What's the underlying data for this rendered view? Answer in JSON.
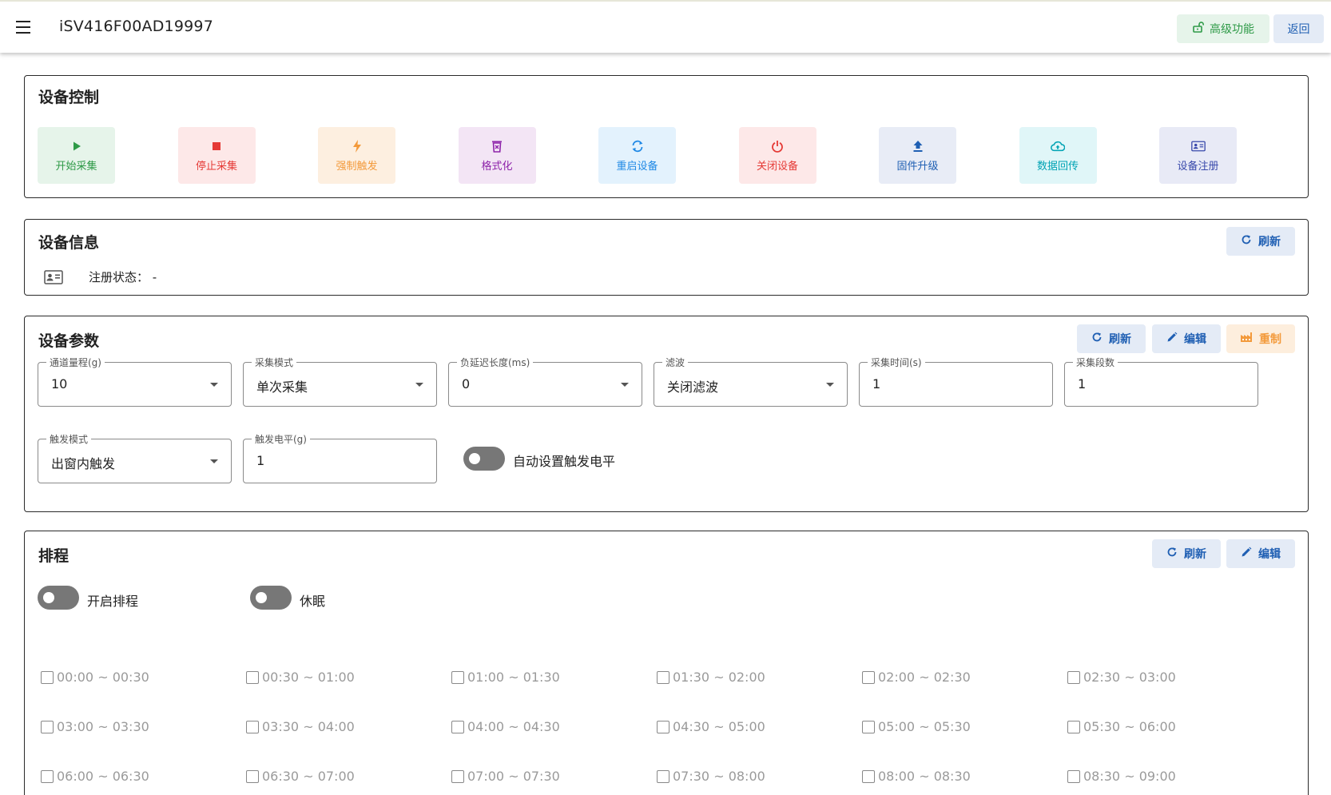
{
  "topbar": {
    "menu_icon": "hamburger-menu-icon",
    "title": "iSV416F00AD19997",
    "advanced_label": "高级功能",
    "back_label": "返回"
  },
  "colors": {
    "start": "#2e9a47",
    "stop": "#e53935",
    "trigger": "#f39a3b",
    "format": "#8e24aa",
    "restart": "#1e88e5",
    "shutdown": "#e53935",
    "firmware": "#1f5fb3",
    "upload": "#00a3b4",
    "register": "#3949ab"
  },
  "device_control": {
    "title": "设备控制",
    "buttons": [
      {
        "label": "开始采集",
        "icon": "play-icon"
      },
      {
        "label": "停止采集",
        "icon": "stop-icon"
      },
      {
        "label": "强制触发",
        "icon": "lightning-icon"
      },
      {
        "label": "格式化",
        "icon": "trash-icon"
      },
      {
        "label": "重启设备",
        "icon": "refresh-icon"
      },
      {
        "label": "关闭设备",
        "icon": "power-icon"
      },
      {
        "label": "固件升级",
        "icon": "upload-icon"
      },
      {
        "label": "数据回传",
        "icon": "cloud-upload-icon"
      },
      {
        "label": "设备注册",
        "icon": "id-card-icon"
      }
    ]
  },
  "device_info": {
    "title": "设备信息",
    "refresh_label": "刷新",
    "register_status_label": "注册状态：",
    "register_status_value": "-"
  },
  "device_params": {
    "title": "设备参数",
    "refresh_label": "刷新",
    "edit_label": "编辑",
    "reset_label": "重制",
    "fields": [
      {
        "label": "通道量程(g)",
        "value": "10",
        "type": "select"
      },
      {
        "label": "采集模式",
        "value": "单次采集",
        "type": "select"
      },
      {
        "label": "负延迟长度(ms)",
        "value": "0",
        "type": "select"
      },
      {
        "label": "滤波",
        "value": "关闭滤波",
        "type": "select"
      },
      {
        "label": "采集时间(s)",
        "value": "1",
        "type": "input"
      },
      {
        "label": "采集段数",
        "value": "1",
        "type": "input"
      },
      {
        "label": "触发模式",
        "value": "出窗内触发",
        "type": "select"
      },
      {
        "label": "触发电平(g)",
        "value": "1",
        "type": "input"
      }
    ],
    "auto_trigger_label": "自动设置触发电平"
  },
  "schedule": {
    "title": "排程",
    "refresh_label": "刷新",
    "edit_label": "编辑",
    "enable_label": "开启排程",
    "sleep_label": "休眠",
    "slots": [
      "00:00 ~ 00:30",
      "00:30 ~ 01:00",
      "01:00 ~ 01:30",
      "01:30 ~ 02:00",
      "02:00 ~ 02:30",
      "02:30 ~ 03:00",
      "03:00 ~ 03:30",
      "03:30 ~ 04:00",
      "04:00 ~ 04:30",
      "04:30 ~ 05:00",
      "05:00 ~ 05:30",
      "05:30 ~ 06:00",
      "06:00 ~ 06:30",
      "06:30 ~ 07:00",
      "07:00 ~ 07:30",
      "07:30 ~ 08:00",
      "08:00 ~ 08:30",
      "08:30 ~ 09:00"
    ]
  }
}
